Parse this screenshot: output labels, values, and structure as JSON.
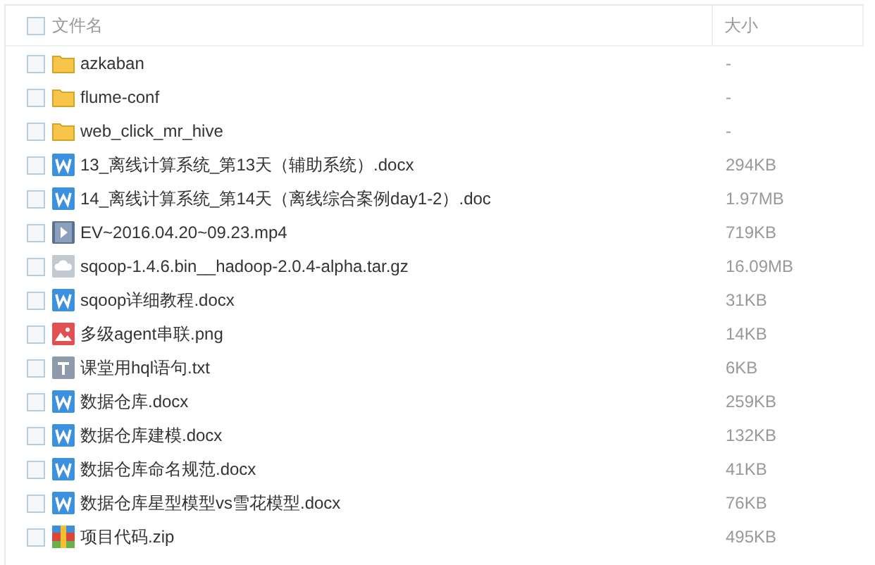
{
  "header": {
    "checked": false,
    "columns": [
      "文件名",
      "大小"
    ]
  },
  "rows": [
    {
      "kind": "folder",
      "name": "azkaban",
      "size": "-",
      "checked": false
    },
    {
      "kind": "folder",
      "name": "flume-conf",
      "size": "-",
      "checked": false
    },
    {
      "kind": "folder",
      "name": "web_click_mr_hive",
      "size": "-",
      "checked": false
    },
    {
      "kind": "word",
      "name": "13_离线计算系统_第13天（辅助系统）.docx",
      "size": "294KB",
      "checked": false
    },
    {
      "kind": "word",
      "name": "14_离线计算系统_第14天（离线综合案例day1-2）.doc",
      "size": "1.97MB",
      "checked": false
    },
    {
      "kind": "video",
      "name": "EV~2016.04.20~09.23.mp4",
      "size": "719KB",
      "checked": false
    },
    {
      "kind": "archive",
      "name": "sqoop-1.4.6.bin__hadoop-2.0.4-alpha.tar.gz",
      "size": "16.09MB",
      "checked": false
    },
    {
      "kind": "word",
      "name": "sqoop详细教程.docx",
      "size": "31KB",
      "checked": false
    },
    {
      "kind": "image",
      "name": "多级agent串联.png",
      "size": "14KB",
      "checked": false
    },
    {
      "kind": "text",
      "name": "课堂用hql语句.txt",
      "size": "6KB",
      "checked": false
    },
    {
      "kind": "word",
      "name": "数据仓库.docx",
      "size": "259KB",
      "checked": false
    },
    {
      "kind": "word",
      "name": "数据仓库建模.docx",
      "size": "132KB",
      "checked": false
    },
    {
      "kind": "word",
      "name": "数据仓库命名规范.docx",
      "size": "41KB",
      "checked": false
    },
    {
      "kind": "word",
      "name": "数据仓库星型模型vs雪花模型.docx",
      "size": "76KB",
      "checked": false
    },
    {
      "kind": "zip",
      "name": "项目代码.zip",
      "size": "495KB",
      "checked": false
    }
  ]
}
